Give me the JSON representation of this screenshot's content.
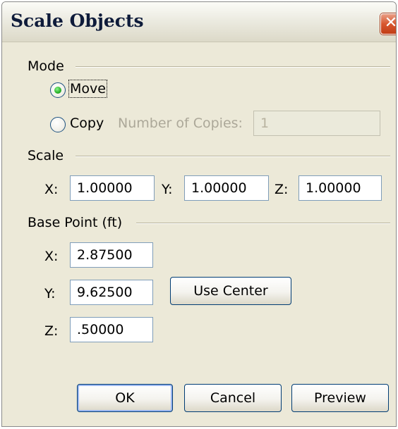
{
  "window": {
    "title": "Scale Objects",
    "close_icon_glyph": "✕"
  },
  "mode": {
    "group_label": "Mode",
    "move_label": "Move",
    "copy_label": "Copy",
    "selected": "Move",
    "copies_label": "Number of Copies:",
    "copies_value": "1"
  },
  "scale": {
    "group_label": "Scale",
    "x_label": "X:",
    "x_value": "1.00000",
    "y_label": "Y:",
    "y_value": "1.00000",
    "z_label": "Z:",
    "z_value": "1.00000"
  },
  "base_point": {
    "group_label": "Base Point (ft)",
    "x_label": "X:",
    "x_value": "2.87500",
    "y_label": "Y:",
    "y_value": "9.62500",
    "z_label": "Z:",
    "z_value": ".50000",
    "use_center_label": "Use Center"
  },
  "buttons": {
    "ok": "OK",
    "cancel": "Cancel",
    "preview": "Preview"
  },
  "colors": {
    "dialog_background": "#ece9d8",
    "radio_selected": "#28b028",
    "close_button": "#d8572f"
  }
}
